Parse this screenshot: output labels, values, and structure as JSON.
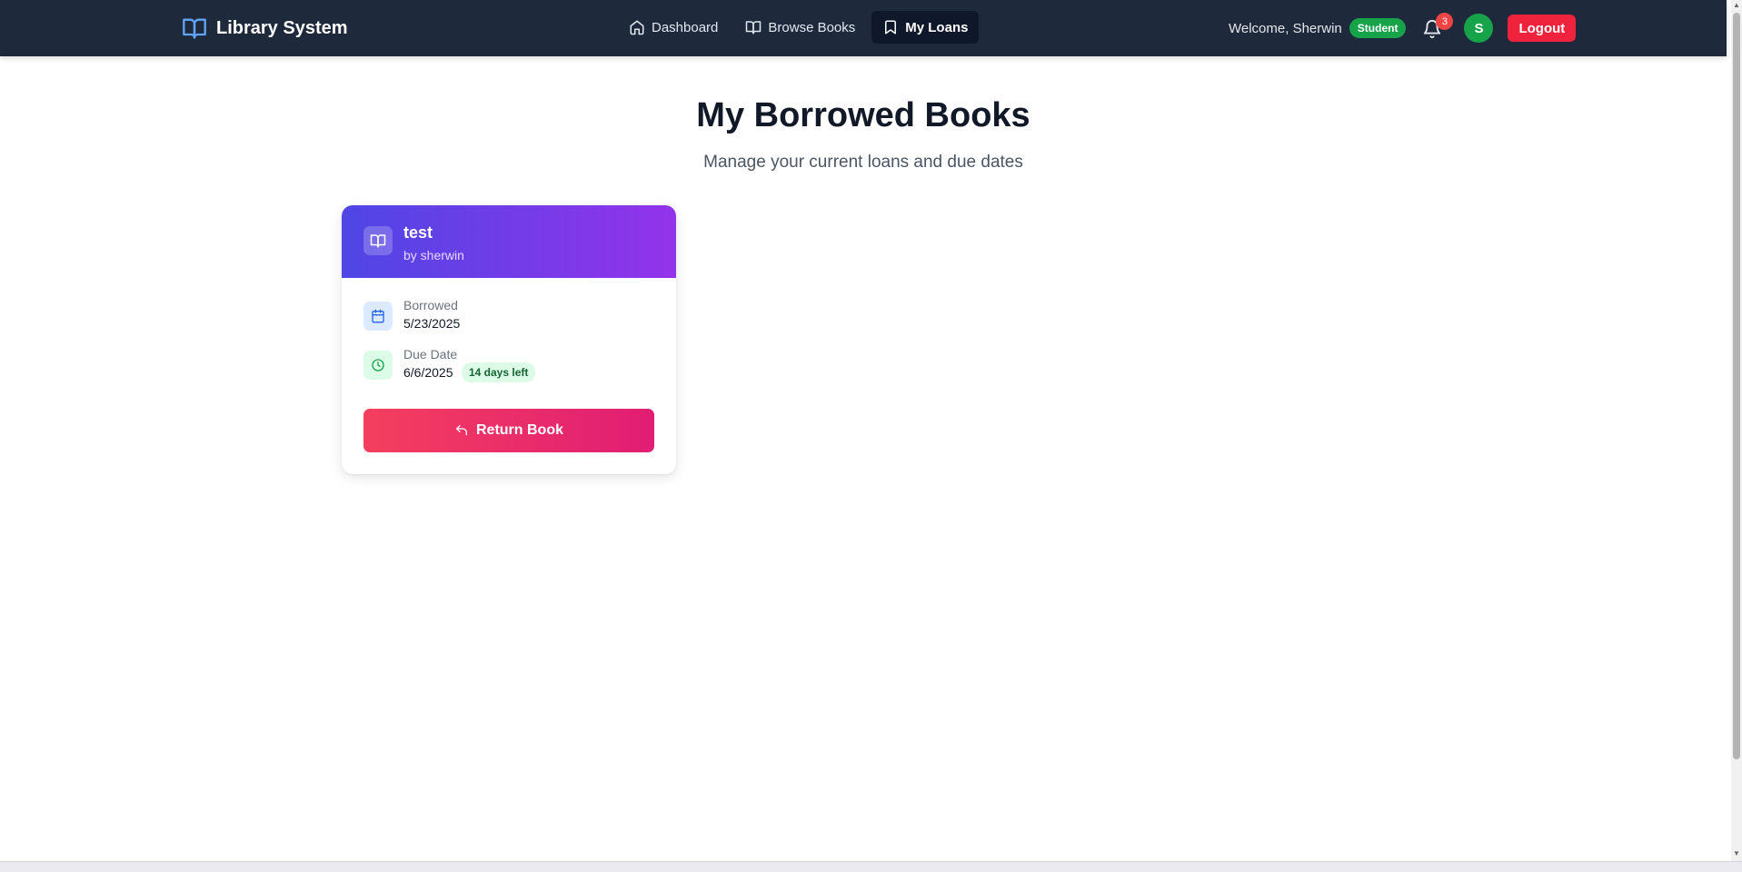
{
  "nav": {
    "brand": "Library System",
    "links": [
      {
        "label": "Dashboard",
        "icon": "home-icon"
      },
      {
        "label": "Browse Books",
        "icon": "book-open-icon"
      },
      {
        "label": "My Loans",
        "icon": "bookmark-icon",
        "active": true
      }
    ],
    "welcome": "Welcome, Sherwin",
    "role": "Student",
    "notification_count": "3",
    "avatar_initial": "S",
    "logout_label": "Logout"
  },
  "page": {
    "title": "My Borrowed Books",
    "subtitle": "Manage your current loans and due dates"
  },
  "loans": [
    {
      "title": "test",
      "author": "by sherwin",
      "borrowed_label": "Borrowed",
      "borrowed_date": "5/23/2025",
      "due_label": "Due Date",
      "due_date": "6/6/2025",
      "days_left": "14 days left",
      "return_label": "Return Book"
    }
  ],
  "colors": {
    "nav_bg": "#1e293b",
    "card_header_start": "#4f46e5",
    "card_header_end": "#9333ea",
    "return_start": "#f43f5e",
    "return_end": "#e11d74",
    "student_badge": "#16a34a",
    "logout": "#ef233c"
  }
}
